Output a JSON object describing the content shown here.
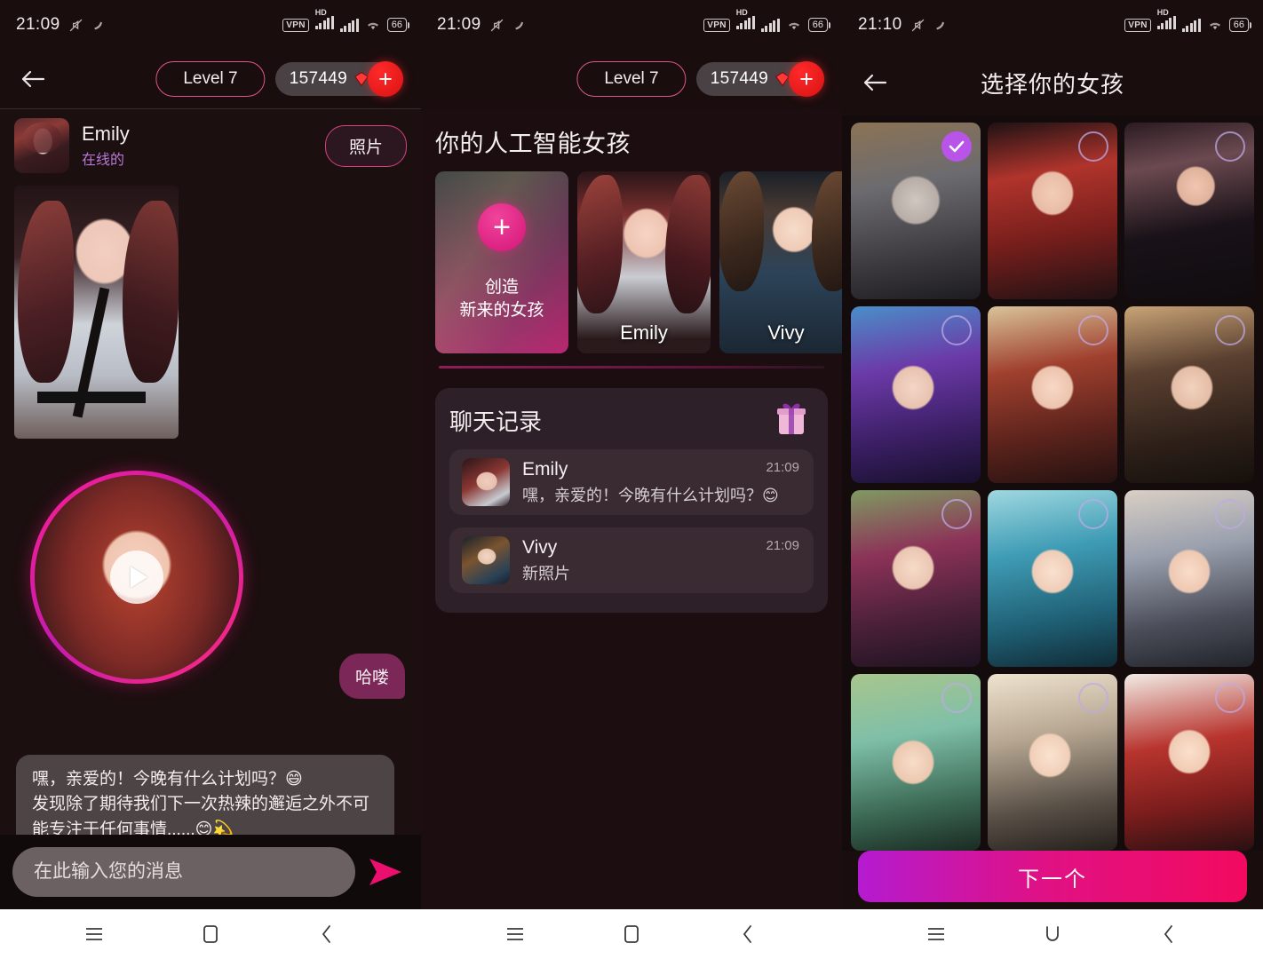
{
  "status_bar": {
    "time_left": "21:09",
    "time_right": "21:10",
    "vpn": "VPN",
    "hd": "HD",
    "battery": "66",
    "icons": [
      "mute-icon",
      "nfc-icon",
      "vpn-icon",
      "hd-icon",
      "signal-icon",
      "wifi-icon",
      "battery-icon"
    ]
  },
  "header": {
    "level_label": "Level 7",
    "coins": "157449",
    "plus_label": "+",
    "back_icon": "back-arrow-icon",
    "coin_icon": "gem-icon"
  },
  "chat_screen": {
    "contact_name": "Emily",
    "contact_status": "在线的",
    "photos_button": "照片",
    "outgoing_message": "哈喽",
    "incoming_message": "嘿，亲爱的！今晚有什么计划吗？😄\n发现除了期待我们下一次热辣的邂逅之外不可能专注于任何事情......😊💫",
    "input_placeholder": "在此输入您的消息",
    "input_value": "",
    "send_icon": "send-icon",
    "play_icon": "play-icon"
  },
  "girls_screen": {
    "title": "你的人工智能女孩",
    "cards": [
      {
        "type": "create",
        "line1": "创造",
        "line2": "新来的女孩",
        "icon": "plus-icon"
      },
      {
        "type": "girl",
        "name": "Emily"
      },
      {
        "type": "girl",
        "name": "Vivy"
      }
    ],
    "history": {
      "title": "聊天记录",
      "gift_icon": "gift-icon",
      "rows": [
        {
          "name": "Emily",
          "preview": "嘿，亲爱的！今晚有什么计划吗？😊",
          "time": "21:09"
        },
        {
          "name": "Vivy",
          "preview": "新照片",
          "time": "21:09"
        }
      ]
    }
  },
  "select_screen": {
    "title": "选择你的女孩",
    "next_button": "下一个",
    "check_icon": "check-icon",
    "girls": [
      {
        "id": 1,
        "selected": true,
        "hair": "silver-elf"
      },
      {
        "id": 2,
        "selected": false,
        "hair": "red"
      },
      {
        "id": 3,
        "selected": false,
        "hair": "black"
      },
      {
        "id": 4,
        "selected": false,
        "hair": "purple"
      },
      {
        "id": 5,
        "selected": false,
        "hair": "auburn"
      },
      {
        "id": 6,
        "selected": false,
        "hair": "brown-bob"
      },
      {
        "id": 7,
        "selected": false,
        "hair": "magenta"
      },
      {
        "id": 8,
        "selected": false,
        "hair": "cyan"
      },
      {
        "id": 9,
        "selected": false,
        "hair": "platinum"
      },
      {
        "id": 10,
        "selected": false,
        "hair": "mint-cat"
      },
      {
        "id": 11,
        "selected": false,
        "hair": "blonde"
      },
      {
        "id": 12,
        "selected": false,
        "hair": "santa-brown"
      }
    ]
  },
  "nav_bar": {
    "menu_icon": "menu-icon",
    "home_icon": "home-icon",
    "back_icon": "back-chevron-icon",
    "recents_icon": "recents-icon"
  },
  "colors": {
    "accent_pink": "#e8117f",
    "accent_purple": "#b855e8",
    "background": "#1a0d0e",
    "coin_red": "#d81212"
  }
}
